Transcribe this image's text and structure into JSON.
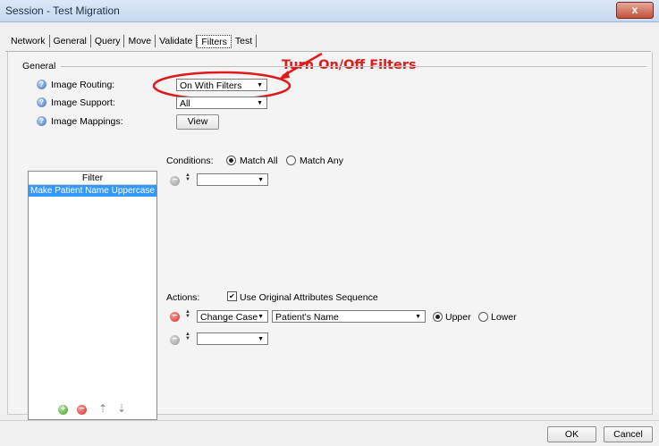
{
  "window": {
    "title": "Session - Test Migration",
    "close_glyph": "x"
  },
  "tabs": [
    "Network",
    "General",
    "Query",
    "Move",
    "Validate",
    "Filters",
    "Test"
  ],
  "active_tab": "Filters",
  "annotation": "Turn On/Off Filters",
  "general": {
    "group_label": "General",
    "image_routing": {
      "label": "Image Routing:",
      "value": "On With Filters"
    },
    "image_support": {
      "label": "Image Support:",
      "value": "All"
    },
    "image_mappings": {
      "label": "Image Mappings:",
      "button": "View"
    }
  },
  "filter_list": {
    "header": "Filter",
    "items": [
      "Make Patient Name Uppercase"
    ]
  },
  "conditions": {
    "label": "Conditions:",
    "match_all": "Match All",
    "match_any": "Match Any",
    "selected": "Match All",
    "combo_value": ""
  },
  "actions": {
    "label": "Actions:",
    "use_original": "Use Original Attributes Sequence",
    "use_original_checked": true,
    "action_type": "Change Case",
    "attribute": "Patient's Name",
    "upper": "Upper",
    "lower": "Lower",
    "case_selected": "Upper",
    "combo_value": ""
  },
  "footer": {
    "ok": "OK",
    "cancel": "Cancel"
  },
  "colors": {
    "annotation": "#e01a1a",
    "selection": "#3399ff"
  }
}
